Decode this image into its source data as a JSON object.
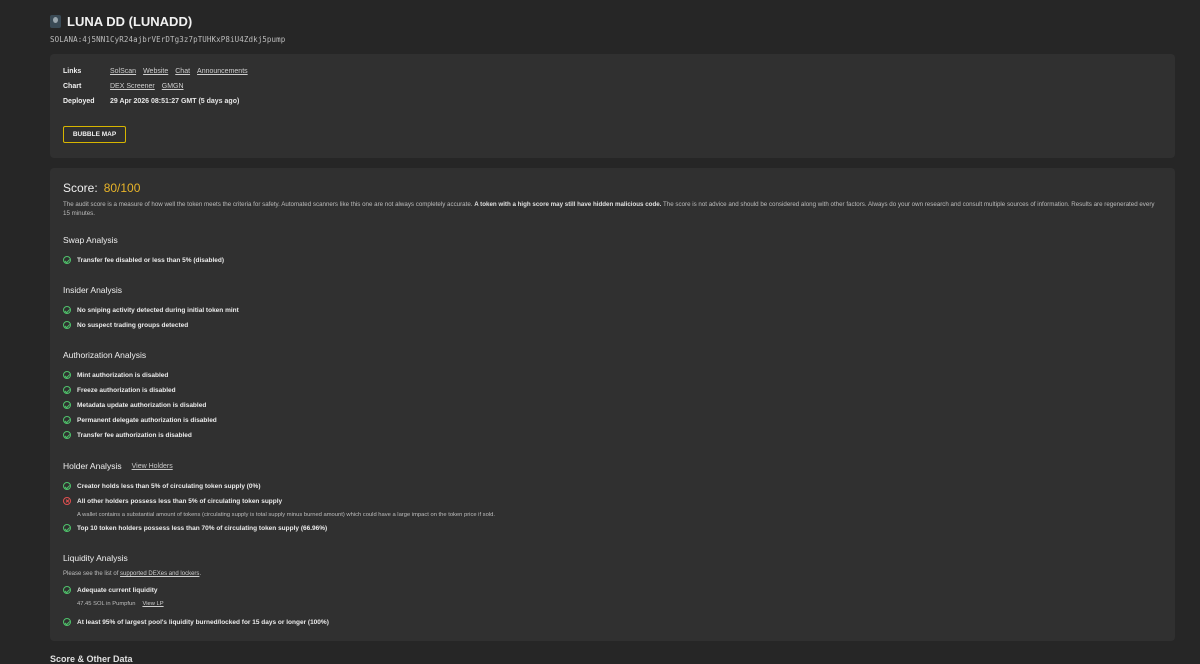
{
  "token": {
    "title": "LUNA DD (LUNADD)",
    "address": "SOLANA:4j5NN1CyR24ajbrVErDTg3z7pTUHKxP8iU4Zdkj5pump"
  },
  "info": {
    "links_label": "Links",
    "links": [
      "SolScan",
      "Website",
      "Chat",
      "Announcements"
    ],
    "chart_label": "Chart",
    "charts": [
      "DEX Screener",
      "GMGN"
    ],
    "deployed_label": "Deployed",
    "deployed_value": "29 Apr 2026 08:51:27 GMT (5 days ago)",
    "bubble_map_label": "BUBBLE MAP"
  },
  "score": {
    "label": "Score:",
    "value": "80/100",
    "desc_part1": "The audit score is a measure of how well the token meets the criteria for safety. Automated scanners like this one are not always completely accurate. ",
    "desc_bold": "A token with a high score may still have hidden malicious code.",
    "desc_part2": " The score is not advice and should be considered along with other factors. Always do your own research and consult multiple sources of information. Results are regenerated every 15 minutes."
  },
  "swap": {
    "title": "Swap Analysis",
    "checks": [
      "Transfer fee disabled or less than 5% (disabled)"
    ]
  },
  "insider": {
    "title": "Insider Analysis",
    "checks": [
      "No sniping activity detected during initial token mint",
      "No suspect trading groups detected"
    ]
  },
  "authorization": {
    "title": "Authorization Analysis",
    "checks": [
      "Mint authorization is disabled",
      "Freeze authorization is disabled",
      "Metadata update authorization is disabled",
      "Permanent delegate authorization is disabled",
      "Transfer fee authorization is disabled"
    ]
  },
  "holder": {
    "title": "Holder Analysis",
    "view_link": "View Holders",
    "check1": "Creator holds less than 5% of circulating token supply (0%)",
    "check2": "All other holders possess less than 5% of circulating token supply",
    "check2_note": "A wallet contains a substantial amount of tokens (circulating supply is total supply minus burned amount) which could have a large impact on the token price if sold.",
    "check3": "Top 10 token holders possess less than 70% of circulating token supply (66.96%)"
  },
  "liquidity": {
    "title": "Liquidity Analysis",
    "note_prefix": "Please see the list of ",
    "note_link": "supported DEXes and lockers",
    "note_suffix": ".",
    "check1": "Adequate current liquidity",
    "check1_note": "47.45 SOL in Pumpfun",
    "check1_link": "View LP",
    "check2": "At least 95% of largest pool's liquidity burned/locked for 15 days or longer (100%)"
  },
  "footer_peek": "Score & Other Data",
  "colors": {
    "accent": "#e8b429",
    "ok": "#4fc36b",
    "fail": "#e05050",
    "button_border": "#d7b500"
  }
}
